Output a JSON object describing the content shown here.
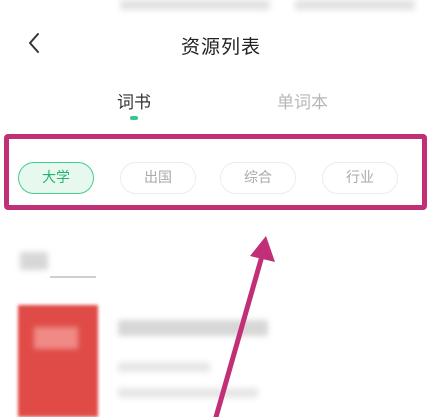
{
  "header": {
    "back_icon": "chevron-left-icon",
    "title": "资源列表"
  },
  "tabs": [
    {
      "label": "词书",
      "active": true
    },
    {
      "label": "单词本",
      "active": false
    }
  ],
  "filters": [
    {
      "label": "大学",
      "selected": true
    },
    {
      "label": "出国",
      "selected": false
    },
    {
      "label": "综合",
      "selected": false
    },
    {
      "label": "行业",
      "selected": false
    }
  ],
  "colors": {
    "accent": "#37c98b",
    "highlight": "#c12f77",
    "book_cover": "#e04b48"
  }
}
